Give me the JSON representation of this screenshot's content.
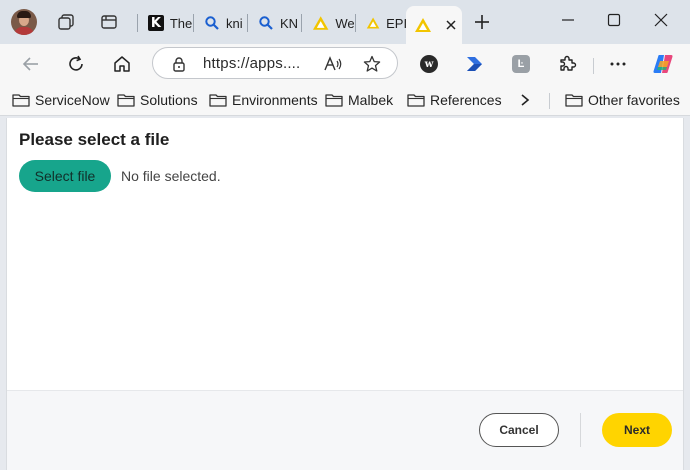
{
  "tabs": [
    {
      "label": "The",
      "icon": "k-logo-icon"
    },
    {
      "label": "kni",
      "icon": "search-icon"
    },
    {
      "label": "KN",
      "icon": "search-icon"
    },
    {
      "label": "We",
      "icon": "triangle-logo-icon"
    },
    {
      "label": "EPI(",
      "icon": "triangle-logo-icon"
    },
    {
      "label": "",
      "icon": "triangle-logo-icon",
      "active": true
    }
  ],
  "address": {
    "url": "https://apps...."
  },
  "bookmarks": [
    {
      "label": "ServiceNow"
    },
    {
      "label": "Solutions"
    },
    {
      "label": "Environments"
    },
    {
      "label": "Malbek"
    },
    {
      "label": "References"
    }
  ],
  "other_favorites": "Other favorites",
  "extensions": {
    "w_label": "w",
    "k_label": "Ŀ"
  },
  "dialog": {
    "title": "Please select a file",
    "select_label": "Select file",
    "no_file_text": "No file selected.",
    "cancel_label": "Cancel",
    "next_label": "Next"
  },
  "colors": {
    "select_button": "#17a58c",
    "next_button": "#ffd400",
    "tab_triangle": "#f2c500"
  }
}
